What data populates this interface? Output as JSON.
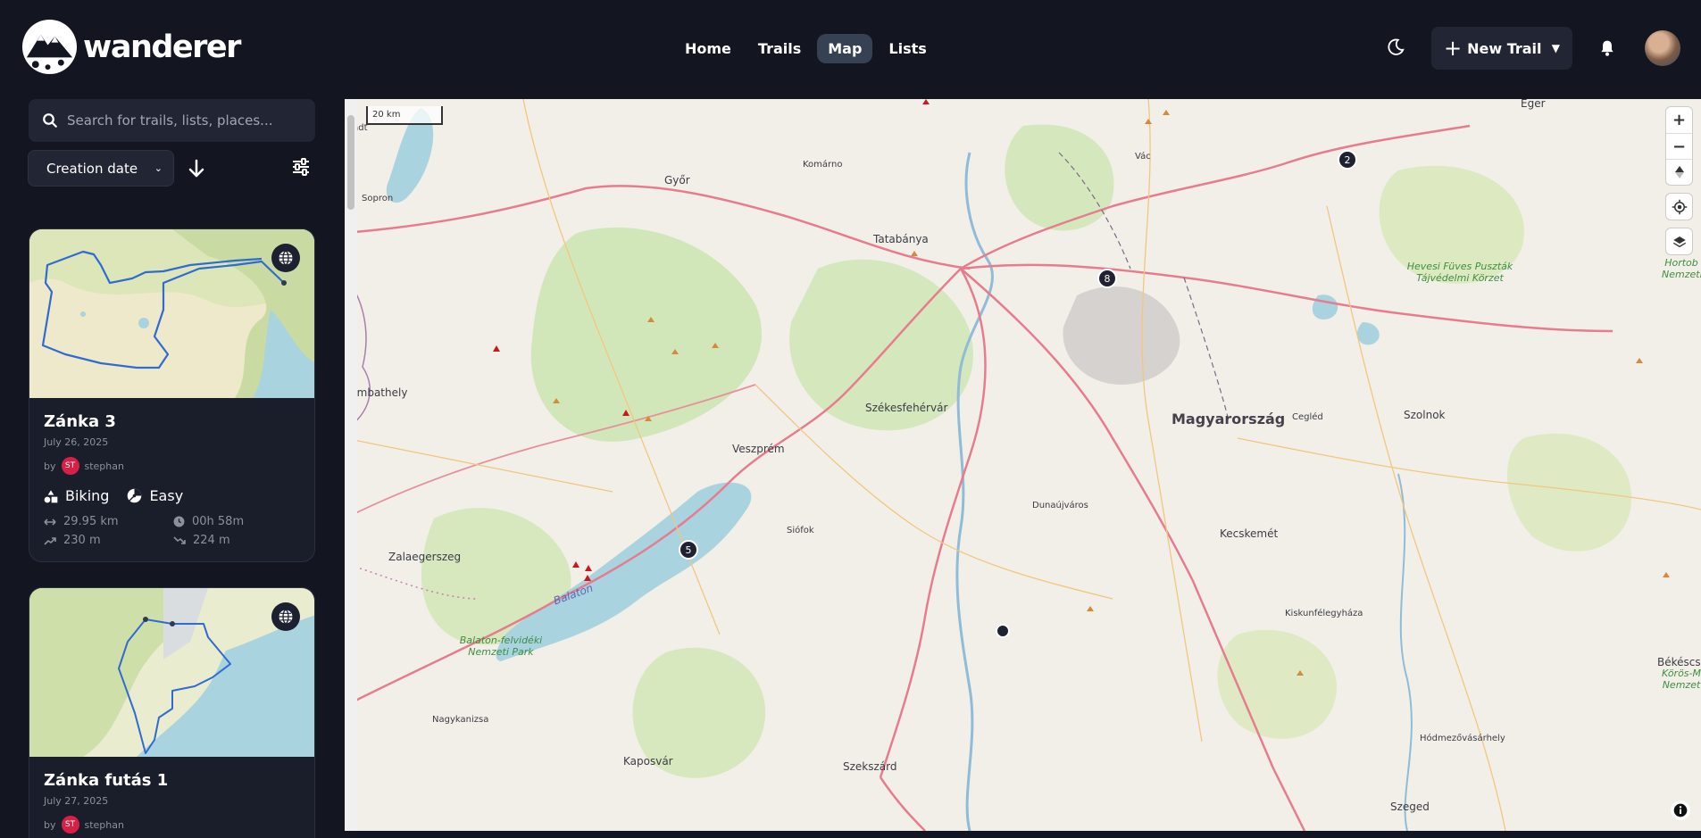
{
  "app": {
    "name": "wanderer"
  },
  "nav": {
    "items": [
      "Home",
      "Trails",
      "Map",
      "Lists"
    ],
    "active": "Map"
  },
  "header": {
    "new_trail_label": "New Trail"
  },
  "sidebar": {
    "search_placeholder": "Search for trails, lists, places...",
    "sort_label": "Creation date"
  },
  "trails": [
    {
      "title": "Zánka 3",
      "date": "July 26, 2025",
      "by": "by",
      "author_initials": "ST",
      "author": "stephan",
      "category": "Biking",
      "difficulty": "Easy",
      "distance": "29.95 km",
      "duration": "00h 58m",
      "elevation_gain": "230 m",
      "elevation_loss": "224 m"
    },
    {
      "title": "Zánka futás 1",
      "date": "July 27, 2025",
      "by": "by",
      "author_initials": "ST",
      "author": "stephan"
    }
  ],
  "map": {
    "scale_label": "20 km",
    "country_label": "Magyarország",
    "cities": [
      {
        "name": "Eger"
      },
      {
        "name": "Komárno"
      },
      {
        "name": "Győr"
      },
      {
        "name": "Vác"
      },
      {
        "name": "Sopron"
      },
      {
        "name": "Tatabánya"
      },
      {
        "name": "Székesfehérvár"
      },
      {
        "name": "Veszprém"
      },
      {
        "name": "Cegléd"
      },
      {
        "name": "Szolnok"
      },
      {
        "name": "Dunaújváros"
      },
      {
        "name": "Siófok"
      },
      {
        "name": "Zalaegerszeg"
      },
      {
        "name": "Kecskemét"
      },
      {
        "name": "Kiskunfélegyháza"
      },
      {
        "name": "Nagykanizsa"
      },
      {
        "name": "Kaposvár"
      },
      {
        "name": "Szekszárd"
      },
      {
        "name": "Hódmezővásárhely"
      },
      {
        "name": "Szeged"
      },
      {
        "name": "Békéscs"
      },
      {
        "name": "zombathely"
      },
      {
        "name": "stadt"
      }
    ],
    "lake_label": "Balaton",
    "parks": [
      {
        "name": "Hevesi Füves Puszták Tájvédelmi Körzet"
      },
      {
        "name": "Balaton-felvidéki Nemzeti Park"
      },
      {
        "name": "Hortob Nemzeti"
      },
      {
        "name": "Körös-M Nemzet"
      }
    ],
    "clusters": [
      "2",
      "8",
      "5"
    ]
  }
}
